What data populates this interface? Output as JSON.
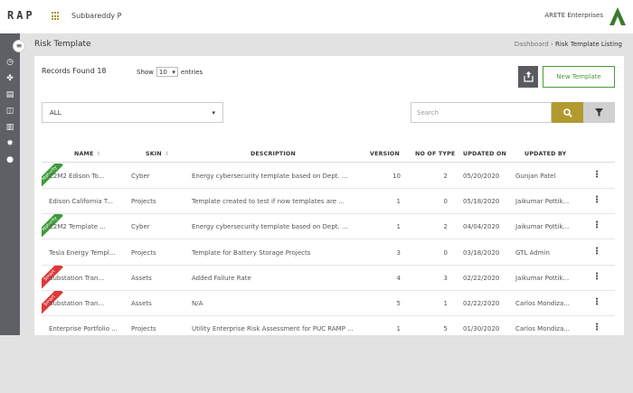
{
  "header": {
    "logo": "RAP",
    "user_name": "Subbareddy P",
    "company": "ARETE Enterprises"
  },
  "page": {
    "title": "Risk Template",
    "breadcrumb": [
      "Dashboard",
      "›",
      "Risk Template Listing"
    ]
  },
  "toolbar": {
    "records_label": "Records Found 18",
    "show_label": "Show",
    "show_value": "10",
    "entries_label": "entries",
    "new_template_label": "New Template"
  },
  "filters": {
    "select_value": "ALL",
    "search_placeholder": "Search"
  },
  "table": {
    "columns": [
      "NAME",
      "SKIN",
      "DESCRIPTION",
      "VERSION",
      "NO OF TYPE",
      "UPDATED ON",
      "UPDATED BY"
    ],
    "rows": [
      {
        "badge": "Maturity",
        "name": "C2M2 Edison To...",
        "skin": "Cyber",
        "description": "Energy cybersecurity template based on Dept. ...",
        "version": "10",
        "types": "2",
        "updated_on": "05/20/2020",
        "updated_by": "Gunjan Patel"
      },
      {
        "badge": "",
        "name": "Edison California T...",
        "skin": "Projects",
        "description": "Template created to test if now templates are ...",
        "version": "1",
        "types": "0",
        "updated_on": "05/18/2020",
        "updated_by": "Jaikumar Pottik..."
      },
      {
        "badge": "Maturity",
        "name": "C2M2 Template ...",
        "skin": "Cyber",
        "description": "Energy cybersecurity template based on Dept. ...",
        "version": "1",
        "types": "2",
        "updated_on": "04/04/2020",
        "updated_by": "Jaikumar Pottik..."
      },
      {
        "badge": "",
        "name": "Tesla Energy Templ...",
        "skin": "Projects",
        "description": "Template for Battery Storage Projects",
        "version": "3",
        "types": "0",
        "updated_on": "03/18/2020",
        "updated_by": "GTL Admin"
      },
      {
        "badge": "Smart",
        "name": "Substation Tran...",
        "skin": "Assets",
        "description": "Added Failure Rate",
        "version": "4",
        "types": "3",
        "updated_on": "02/22/2020",
        "updated_by": "Jaikumar Pottik..."
      },
      {
        "badge": "Smart",
        "name": "Substation Tran...",
        "skin": "Assets",
        "description": "N/A",
        "version": "5",
        "types": "1",
        "updated_on": "02/22/2020",
        "updated_by": "Carlos Mondiza..."
      },
      {
        "badge": "",
        "name": "Enterprise Portfolio ...",
        "skin": "Projects",
        "description": "Utility Enterprise Risk Assessment for PUC RAMP ...",
        "version": "1",
        "types": "5",
        "updated_on": "01/30/2020",
        "updated_by": "Carlos Mondiza..."
      }
    ]
  },
  "icons": {
    "sidebar": [
      "dashboard-icon",
      "risk-icon",
      "document-icon",
      "layout-icon",
      "chart-icon",
      "settings-icon",
      "user-icon"
    ]
  },
  "colors": {
    "accent_gold": "#b39a2f",
    "green": "#4a9a3a",
    "badge_green": "#3b9b36",
    "badge_red": "#e0383a",
    "sidebar": "#5f5f66"
  }
}
